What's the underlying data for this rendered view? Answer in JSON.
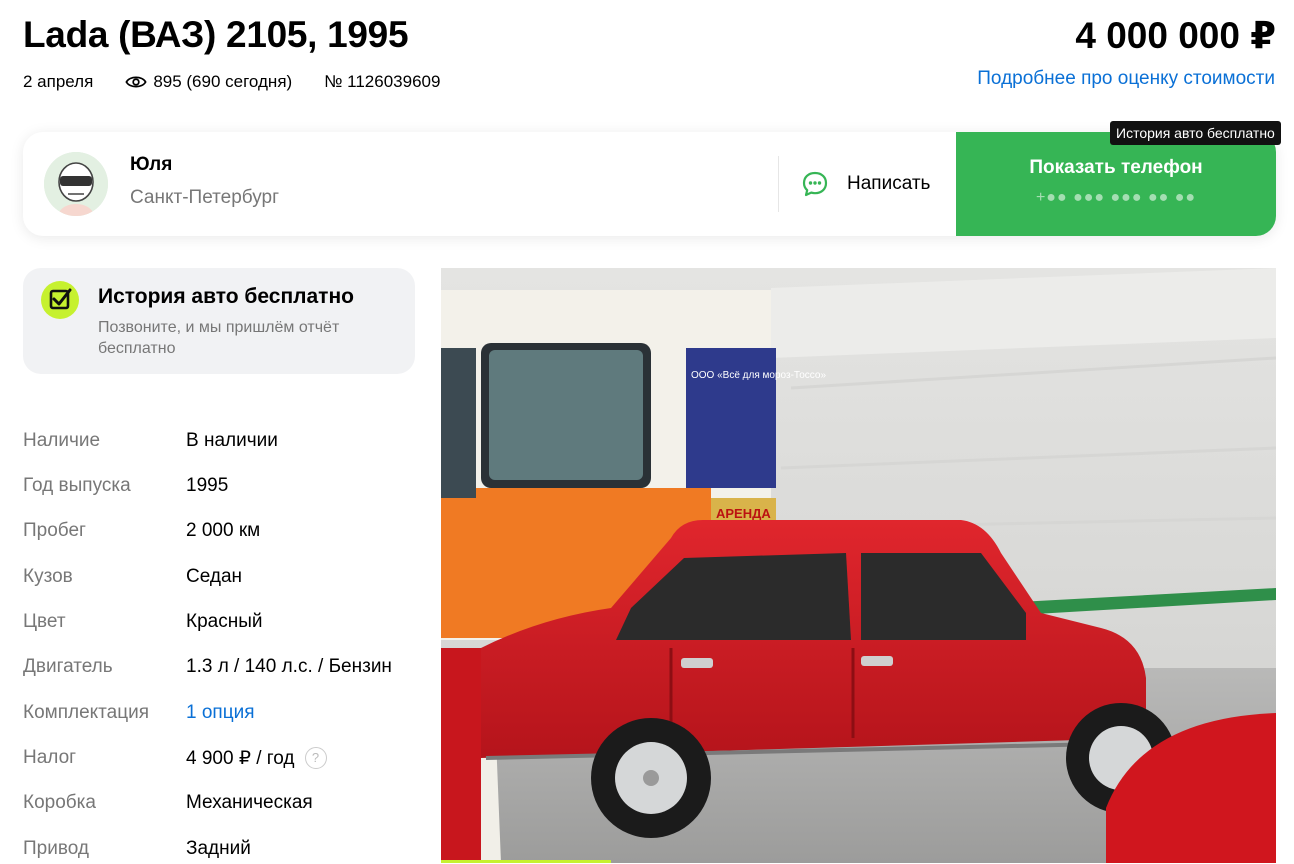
{
  "listing": {
    "title": "Lada (ВАЗ) 2105, 1995",
    "date": "2 апреля",
    "views": "895 (690 сегодня)",
    "number": "№ 1126039609",
    "price": "4 000 000 ₽",
    "price_link": "Подробнее про оценку стоимости"
  },
  "seller": {
    "name": "Юля",
    "city": "Санкт-Петербург",
    "write_label": "Написать",
    "phone_label": "Показать телефон",
    "phone_mask": "+●● ●●● ●●● ●● ●●"
  },
  "tooltip": "История авто бесплатно",
  "history": {
    "title": "История авто бесплатно",
    "subtitle": "Позвоните, и мы пришлём отчёт бесплатно"
  },
  "specs": [
    {
      "label": "Наличие",
      "value": "В наличии"
    },
    {
      "label": "Год выпуска",
      "value": "1995"
    },
    {
      "label": "Пробег",
      "value": "2 000 км"
    },
    {
      "label": "Кузов",
      "value": "Седан"
    },
    {
      "label": "Цвет",
      "value": "Красный"
    },
    {
      "label": "Двигатель",
      "value": "1.3 л / 140 л.с. / Бензин"
    },
    {
      "label": "Комплектация",
      "value": "1 опция"
    },
    {
      "label": "Налог",
      "value": "4 900 ₽ / год"
    },
    {
      "label": "Коробка",
      "value": "Механическая"
    },
    {
      "label": "Привод",
      "value": "Задний"
    }
  ],
  "icons": {
    "eye": "eye-icon",
    "chat": "chat-bubble-icon",
    "history": "checklist-icon",
    "help": "question-icon"
  },
  "colors": {
    "accent_green": "#36b555",
    "link_blue": "#0a70d6",
    "history_icon_bg": "#c6f12f"
  },
  "photo": {
    "bus_sign": "ООО «Всё для мороз-Тоссо»",
    "bus_sign_2": "АРЕНДА"
  }
}
